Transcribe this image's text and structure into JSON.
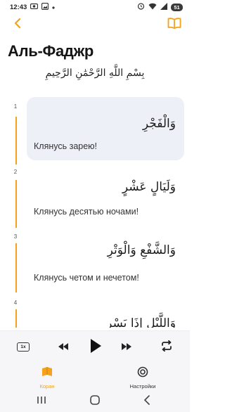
{
  "status_bar": {
    "time": "12:43",
    "battery": "51"
  },
  "header": {
    "title": "Аль-Фаджр",
    "back_icon": "chevron-left-icon",
    "book_icon": "open-book-icon"
  },
  "bismillah": "بِسْمِ اللَّهِ الرَّحْمَٰنِ الرَّحِيمِ",
  "ayahs": [
    {
      "number": "1",
      "arabic": "وَالْفَجْرِ",
      "translation": "Клянусь зарею!",
      "active": true
    },
    {
      "number": "2",
      "arabic": "وَلَيَالٍ عَشْرٍ",
      "translation": "Клянусь десятью ночами!",
      "active": false
    },
    {
      "number": "3",
      "arabic": "وَالشَّفْعِ وَالْوَتْرِ",
      "translation": "Клянусь четом и нечетом!",
      "active": false
    },
    {
      "number": "4",
      "arabic": "وَاللَّيْلِ إِذَا يَسْرِ",
      "translation": "",
      "active": false
    }
  ],
  "player": {
    "speed": "1x",
    "accent_color": "#f3a21a"
  },
  "bottom_nav": {
    "items": [
      {
        "label": "Коран",
        "icon": "quran-book-icon",
        "active": true
      },
      {
        "label": "Настройки",
        "icon": "settings-icon",
        "active": false
      }
    ]
  }
}
